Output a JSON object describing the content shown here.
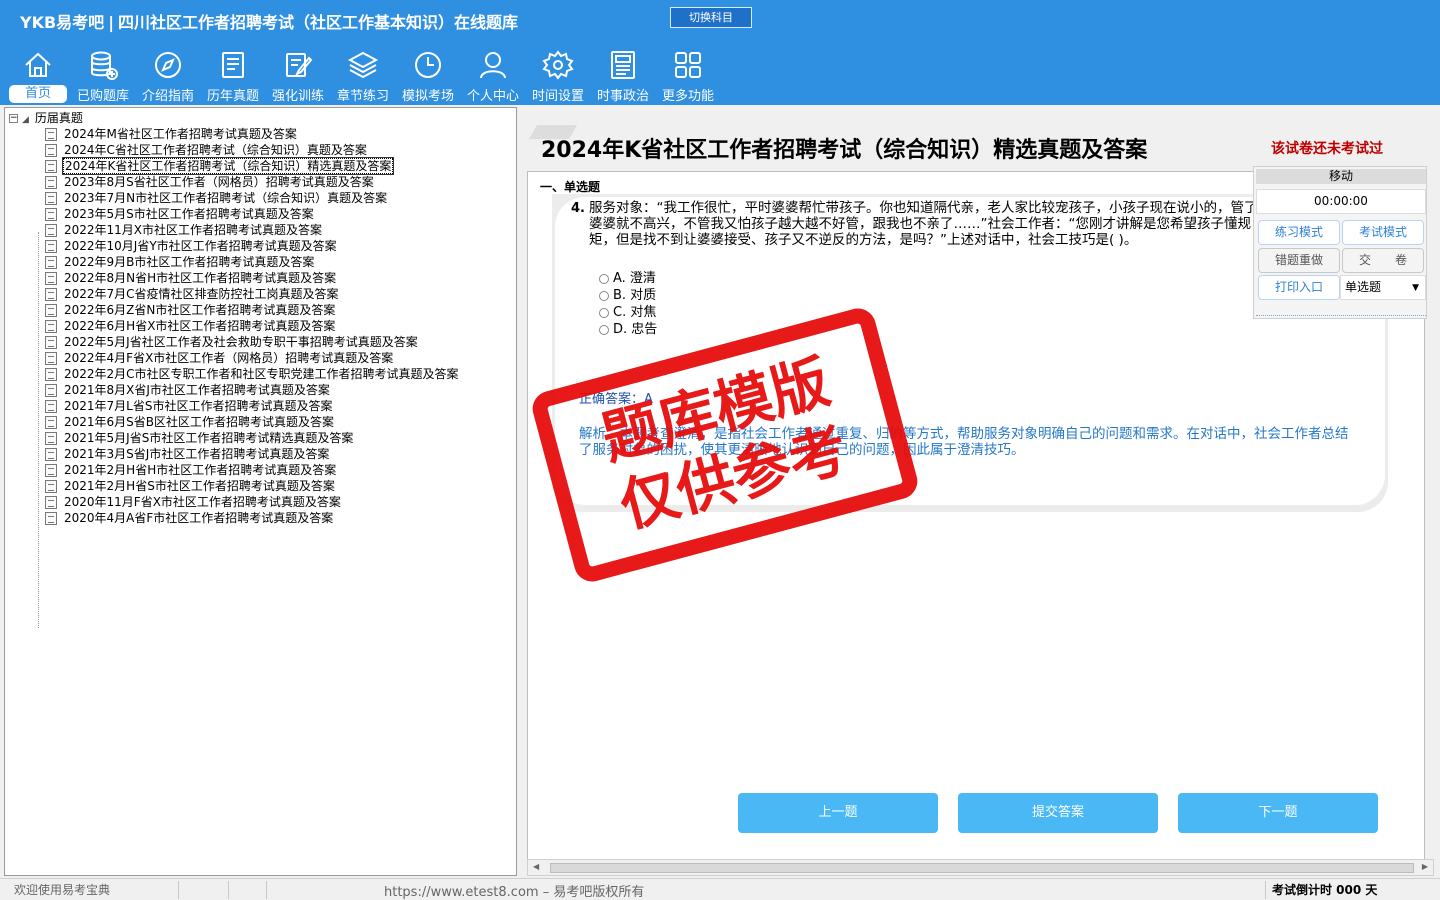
{
  "app": {
    "brand": "YKB易考吧",
    "title": "四川社区工作者招聘考试（社区工作基本知识）在线题库",
    "switch_button": "切换科目"
  },
  "nav": [
    {
      "label": "首页",
      "icon": "home-icon"
    },
    {
      "label": "已购题库",
      "icon": "database-icon"
    },
    {
      "label": "介绍指南",
      "icon": "compass-icon"
    },
    {
      "label": "历年真题",
      "icon": "paper-icon"
    },
    {
      "label": "强化训练",
      "icon": "edit-icon"
    },
    {
      "label": "章节练习",
      "icon": "layers-icon"
    },
    {
      "label": "模拟考场",
      "icon": "clock-icon"
    },
    {
      "label": "个人中心",
      "icon": "user-icon"
    },
    {
      "label": "时间设置",
      "icon": "gear-icon"
    },
    {
      "label": "时事政治",
      "icon": "news-icon"
    },
    {
      "label": "更多功能",
      "icon": "grid-icon"
    }
  ],
  "tree": {
    "root": "历届真题",
    "items": [
      "2024年M省社区工作者招聘考试真题及答案",
      "2024年C省社区工作者招聘考试（综合知识）真题及答案",
      "2024年K省社区工作者招聘考试（综合知识）精选真题及答案",
      "2023年8月S省社区工作者（网格员）招聘考试真题及答案",
      "2023年7月N市社区工作者招聘考试（综合知识）真题及答案",
      "2023年5月S市社区工作者招聘考试真题及答案",
      "2022年11月X市社区工作者招聘考试真题及答案",
      "2022年10月J省Y市社区工作者招聘考试真题及答案",
      "2022年9月B市社区工作者招聘考试真题及答案",
      "2022年8月N省H市社区工作者招聘考试真题及答案",
      "2022年7月C省疫情社区排查防控社工岗真题及答案",
      "2022年6月Z省N市社区工作者招聘考试真题及答案",
      "2022年6月H省X市社区工作者招聘考试真题及答案",
      "2022年5月J省社区工作者及社会救助专职干事招聘考试真题及答案",
      "2022年4月F省X市社区工作者（网格员）招聘考试真题及答案",
      "2022年2月C市社区专职工作者和社区专职党建工作者招聘考试真题及答案",
      "2021年8月X省J市社区工作者招聘考试真题及答案",
      "2021年7月L省S市社区工作者招聘考试真题及答案",
      "2021年6月S省B区社区工作者招聘考试真题及答案",
      "2021年5月J省S市社区工作者招聘考试精选真题及答案",
      "2021年3月S省J市社区工作者招聘考试真题及答案",
      "2021年2月H省H市社区工作者招聘考试真题及答案",
      "2021年2月H省S市社区工作者招聘考试真题及答案",
      "2020年11月F省X市社区工作者招聘考试真题及答案",
      "2020年4月A省F市社区工作者招聘考试真题及答案"
    ]
  },
  "exam": {
    "title": "2024年K省社区工作者招聘考试（综合知识）精选真题及答案",
    "status": "该试卷还未考试过",
    "section": "一、单选题",
    "question_number": "4.",
    "question_text": "服务对象：“我工作很忙，平时婆婆帮忙带孩子。你也知道隔代亲，老人家比较宠孩子，小孩子现在说小的，管了婆婆就不高兴，不管我又怕孩子越大越不好管，跟我也不亲了……”社会工作者：“您刚才讲解是您希望孩子懂规矩，但是找不到让婆婆接受、孩子又不逆反的方法，是吗？”上述对话中，社会工技巧是(     )。",
    "options": [
      "A. 澄清",
      "B. 对质",
      "C. 对焦",
      "D. 忠告"
    ],
    "answer_label": "正确答案：A",
    "analysis": "解析：本题考查澄清，是指社会工作者通过重复、归纳等方式，帮助服务对象明确自己的问题和需求。在对话中，社会工作者总结了服务对象的困扰，使其更清晰地认识到自己的问题，因此属于澄清技巧。"
  },
  "panel": {
    "move": "移动",
    "timer": "00:00:00",
    "practice_mode": "练习模式",
    "exam_mode": "考试模式",
    "wrong_redo": "错题重做",
    "submit_paper": "交　　卷",
    "print_entry": "打印入口",
    "type_selected": "单选题"
  },
  "buttons": {
    "prev": "上一题",
    "submit": "提交答案",
    "next": "下一题"
  },
  "statusbar": {
    "welcome": "欢迎使用易考宝典",
    "copyright": "https://www.etest8.com – 易考吧版权所有",
    "countdown": "考试倒计时 000 天"
  },
  "watermark": {
    "line1": "题库模版",
    "line2": "仅供参考"
  },
  "colors": {
    "header_blue": "#2f8fe0",
    "button_blue": "#4ab8f5",
    "status_red": "#c00000",
    "stamp_red": "#e60d0d"
  }
}
